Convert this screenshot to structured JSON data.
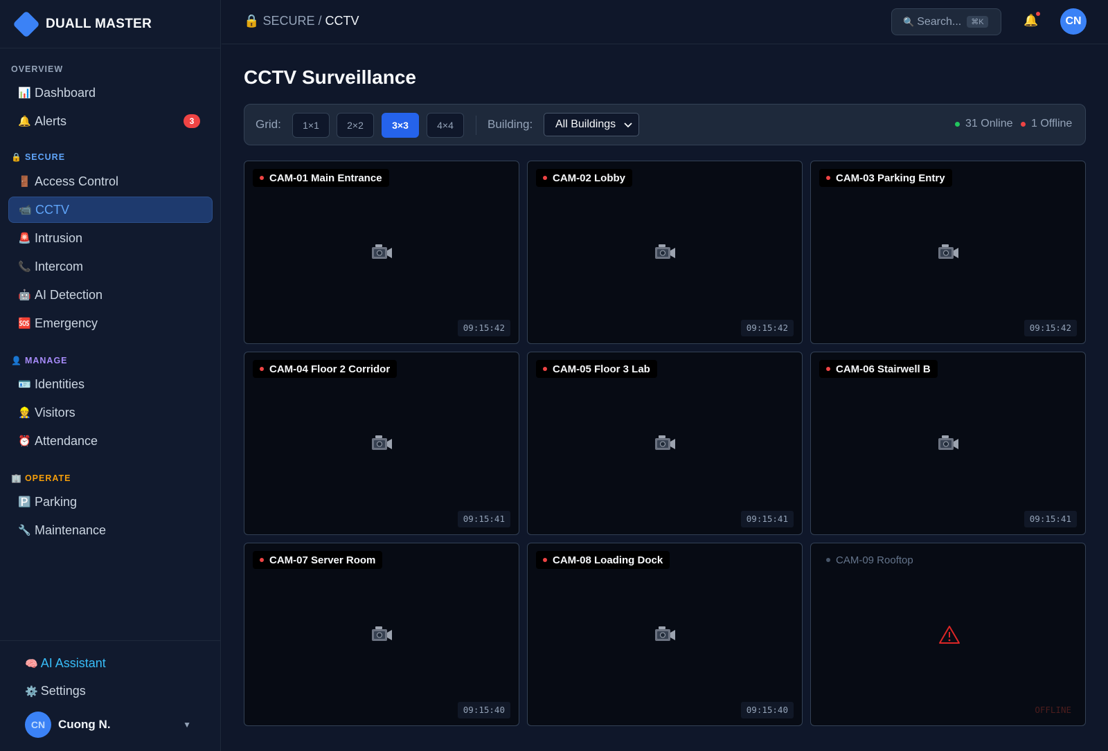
{
  "brand": {
    "name": "DUALL MASTER"
  },
  "sidebar": {
    "sections": [
      {
        "title": "OVERVIEW",
        "icon": "",
        "color": "#94a3b8"
      },
      {
        "title": "SECURE",
        "icon": "🔒",
        "color": "#60a5fa"
      },
      {
        "title": "MANAGE",
        "icon": "👤",
        "color": "#a78bfa"
      },
      {
        "title": "OPERATE",
        "icon": "🏢",
        "color": "#f59e0b"
      }
    ],
    "items": [
      {
        "label": "Dashboard",
        "icon": "📊"
      },
      {
        "label": "Alerts",
        "icon": "🔔",
        "badge": "3"
      },
      {
        "label": "Access Control",
        "icon": "🚪"
      },
      {
        "label": "CCTV",
        "icon": "📹",
        "active": true
      },
      {
        "label": "Intrusion",
        "icon": "🚨"
      },
      {
        "label": "Intercom",
        "icon": "📞"
      },
      {
        "label": "AI Detection",
        "icon": "🤖"
      },
      {
        "label": "Emergency",
        "icon": "🆘"
      },
      {
        "label": "Identities",
        "icon": "🪪"
      },
      {
        "label": "Visitors",
        "icon": "👷"
      },
      {
        "label": "Attendance",
        "icon": "⏰"
      },
      {
        "label": "Parking",
        "icon": "🅿️"
      },
      {
        "label": "Maintenance",
        "icon": "🔧"
      }
    ],
    "footer": {
      "ai_assistant": {
        "label": "AI Assistant",
        "icon": "🧠"
      },
      "settings": {
        "label": "Settings",
        "icon": "⚙️"
      },
      "user": {
        "initials": "CN",
        "name": "Cuong N."
      }
    }
  },
  "topbar": {
    "breadcrumb": {
      "icon": "🔒",
      "parent": "SECURE",
      "separator": "/",
      "current": "CCTV"
    },
    "search": {
      "placeholder": "Search...",
      "shortcut": "⌘K",
      "icon": "🔍"
    },
    "bell_icon": "🔔",
    "avatar_initials": "CN"
  },
  "main": {
    "title": "CCTV Surveillance",
    "toolbar": {
      "grid_label": "Grid:",
      "grid_options": [
        "1×1",
        "2×2",
        "3×3",
        "4×4"
      ],
      "grid_selected": "3×3",
      "building_label": "Building:",
      "building_value": "All Buildings",
      "online_text": "31 Online",
      "offline_text": "1 Offline",
      "online_color": "#22c55e",
      "offline_color": "#ef4444"
    },
    "cameras": [
      {
        "label": "CAM-01 Main Entrance",
        "time": "09:15:42",
        "status": "live"
      },
      {
        "label": "CAM-02 Lobby",
        "time": "09:15:42",
        "status": "live"
      },
      {
        "label": "CAM-03 Parking Entry",
        "time": "09:15:42",
        "status": "live"
      },
      {
        "label": "CAM-04 Floor 2 Corridor",
        "time": "09:15:41",
        "status": "live"
      },
      {
        "label": "CAM-05 Floor 3 Lab",
        "time": "09:15:41",
        "status": "live"
      },
      {
        "label": "CAM-06 Stairwell B",
        "time": "09:15:41",
        "status": "live"
      },
      {
        "label": "CAM-07 Server Room",
        "time": "09:15:40",
        "status": "live"
      },
      {
        "label": "CAM-08 Loading Dock",
        "time": "09:15:40",
        "status": "live"
      },
      {
        "label": "CAM-09 Rooftop",
        "time": "OFFLINE",
        "status": "offline"
      }
    ]
  }
}
